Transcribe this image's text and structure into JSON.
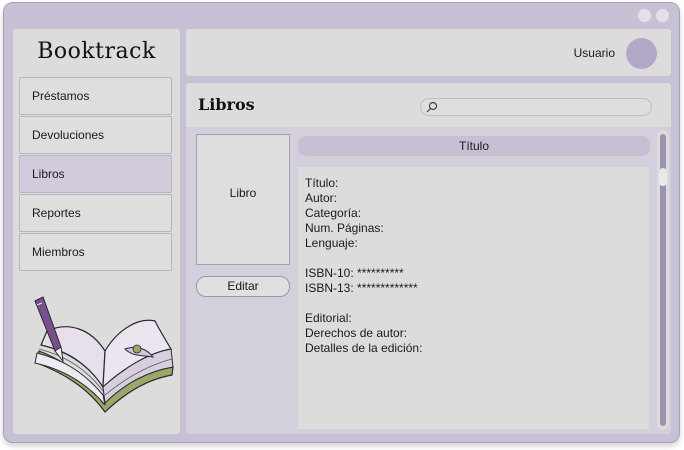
{
  "app": {
    "title": "Booktrack"
  },
  "sidebar": {
    "items": [
      {
        "label": "Préstamos"
      },
      {
        "label": "Devoluciones"
      },
      {
        "label": "Libros",
        "active": true
      },
      {
        "label": "Reportes"
      },
      {
        "label": "Miembros"
      }
    ],
    "illustration_icon": "open-book-with-pen-icon"
  },
  "header": {
    "user_label": "Usuario",
    "avatar_icon": "user-avatar-icon"
  },
  "main": {
    "title": "Libros",
    "search": {
      "placeholder": "",
      "value": "",
      "icon": "search-icon"
    },
    "cover_label": "Libro",
    "edit_label": "Editar",
    "book_title": "Título",
    "details": {
      "titulo": "Título:",
      "autor": "Autor:",
      "categoria": "Categoría:",
      "paginas": "Num. Páginas:",
      "lenguaje": "Lenguaje:",
      "isbn10": "ISBN-10: **********",
      "isbn13": "ISBN-13: *************",
      "editorial": "Editorial:",
      "derechos": "Derechos de autor:",
      "edicion": "Detalles de la edición:"
    }
  },
  "colors": {
    "window_bg": "#c8c0d4",
    "panel_bg": "#dcdcdc",
    "accent": "#b3a8c6",
    "active_nav": "#d3cbdc"
  }
}
